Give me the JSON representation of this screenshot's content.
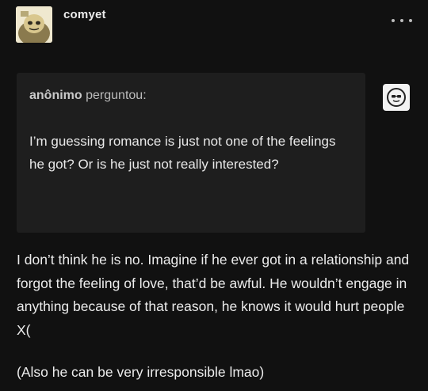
{
  "post": {
    "username": "comyet",
    "menu_icon": "more-dots-icon"
  },
  "ask": {
    "asker_name": "anônimo",
    "asker_verb": "perguntou:",
    "asker_avatar_icon": "anonymous-sunglasses-face-icon",
    "question": "I’m guessing romance is just not one of the feelings he got? Or is he just not really interested?"
  },
  "answer": {
    "paragraph_1": "I don’t think he is no. Imagine if he ever got in a relationship and forgot the feeling of love, that’d be awful. He wouldn’t engage in anything because of that reason, he knows it would hurt people X(",
    "paragraph_2": "(Also he can be very irresponsible lmao)"
  }
}
